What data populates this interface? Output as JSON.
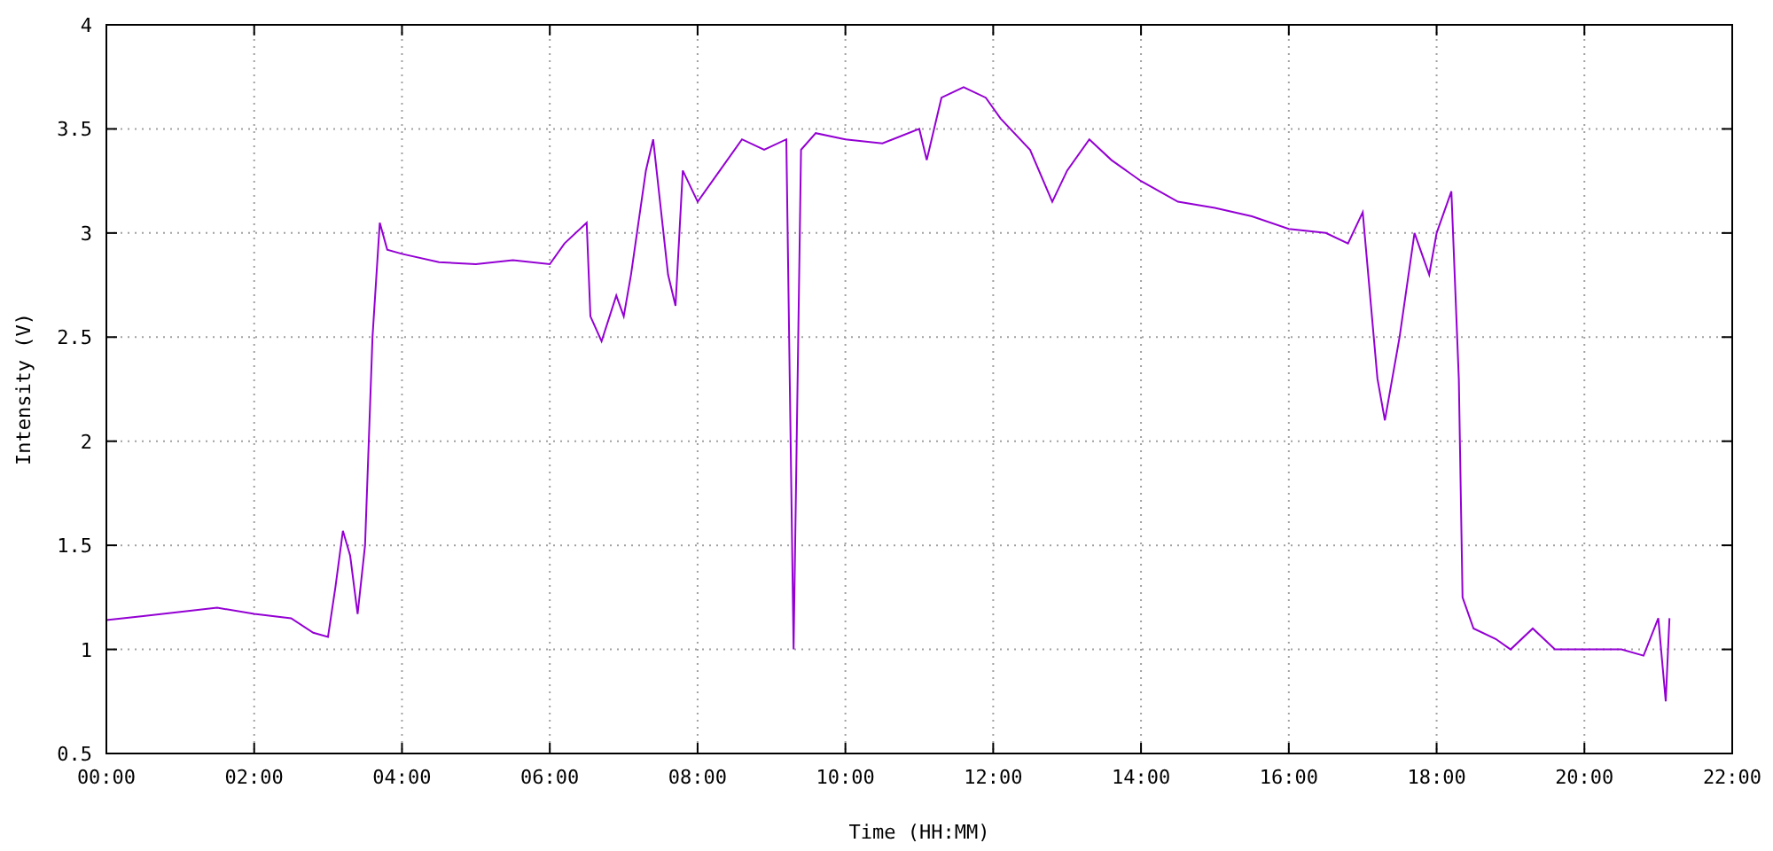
{
  "chart_data": {
    "type": "line",
    "grid": true,
    "xlabel": "Time (HH:MM)",
    "ylabel": "Intensity (V)",
    "xlim": [
      0,
      22
    ],
    "ylim": [
      0.5,
      4
    ],
    "xticks": [
      {
        "value": 0,
        "label": "00:00"
      },
      {
        "value": 2,
        "label": "02:00"
      },
      {
        "value": 4,
        "label": "04:00"
      },
      {
        "value": 6,
        "label": "06:00"
      },
      {
        "value": 8,
        "label": "08:00"
      },
      {
        "value": 10,
        "label": "10:00"
      },
      {
        "value": 12,
        "label": "12:00"
      },
      {
        "value": 14,
        "label": "14:00"
      },
      {
        "value": 16,
        "label": "16:00"
      },
      {
        "value": 18,
        "label": "18:00"
      },
      {
        "value": 20,
        "label": "20:00"
      },
      {
        "value": 22,
        "label": "22:00"
      }
    ],
    "yticks": [
      {
        "value": 0.5,
        "label": "0.5"
      },
      {
        "value": 1,
        "label": "1"
      },
      {
        "value": 1.5,
        "label": "1.5"
      },
      {
        "value": 2,
        "label": "2"
      },
      {
        "value": 2.5,
        "label": "2.5"
      },
      {
        "value": 3,
        "label": "3"
      },
      {
        "value": 3.5,
        "label": "3.5"
      },
      {
        "value": 4,
        "label": "4"
      }
    ],
    "x": [
      0,
      0.5,
      1,
      1.5,
      2,
      2.5,
      2.8,
      3,
      3.1,
      3.2,
      3.3,
      3.4,
      3.5,
      3.6,
      3.7,
      3.8,
      4,
      4.5,
      5,
      5.5,
      6,
      6.2,
      6.5,
      6.55,
      6.7,
      6.9,
      7,
      7.1,
      7.3,
      7.4,
      7.6,
      7.7,
      7.8,
      8,
      8.3,
      8.6,
      8.9,
      9.2,
      9.3,
      9.4,
      9.6,
      10,
      10.5,
      11,
      11.1,
      11.3,
      11.6,
      11.9,
      12.1,
      12.5,
      12.8,
      13,
      13.3,
      13.6,
      14,
      14.5,
      15,
      15.5,
      16,
      16.5,
      16.8,
      17,
      17.2,
      17.3,
      17.5,
      17.7,
      17.9,
      18,
      18.2,
      18.3,
      18.35,
      18.5,
      18.8,
      19,
      19.3,
      19.6,
      20,
      20.5,
      20.8,
      21,
      21.1,
      21.15
    ],
    "series": [
      {
        "color": "#9400d3",
        "values": [
          1.14,
          1.16,
          1.18,
          1.2,
          1.17,
          1.15,
          1.08,
          1.06,
          1.3,
          1.57,
          1.45,
          1.17,
          1.5,
          2.5,
          3.05,
          2.92,
          2.9,
          2.86,
          2.85,
          2.87,
          2.85,
          2.95,
          3.05,
          2.6,
          2.48,
          2.7,
          2.6,
          2.8,
          3.3,
          3.45,
          2.8,
          2.65,
          3.3,
          3.15,
          3.3,
          3.45,
          3.4,
          3.45,
          1.0,
          3.4,
          3.48,
          3.45,
          3.43,
          3.5,
          3.35,
          3.65,
          3.7,
          3.65,
          3.55,
          3.4,
          3.15,
          3.3,
          3.45,
          3.35,
          3.25,
          3.15,
          3.12,
          3.08,
          3.02,
          3.0,
          2.95,
          3.1,
          2.3,
          2.1,
          2.5,
          3.0,
          2.8,
          3.0,
          3.2,
          2.3,
          1.25,
          1.1,
          1.05,
          1.0,
          1.1,
          1.0,
          1.0,
          1.0,
          0.97,
          1.15,
          0.75,
          1.15
        ]
      }
    ]
  }
}
